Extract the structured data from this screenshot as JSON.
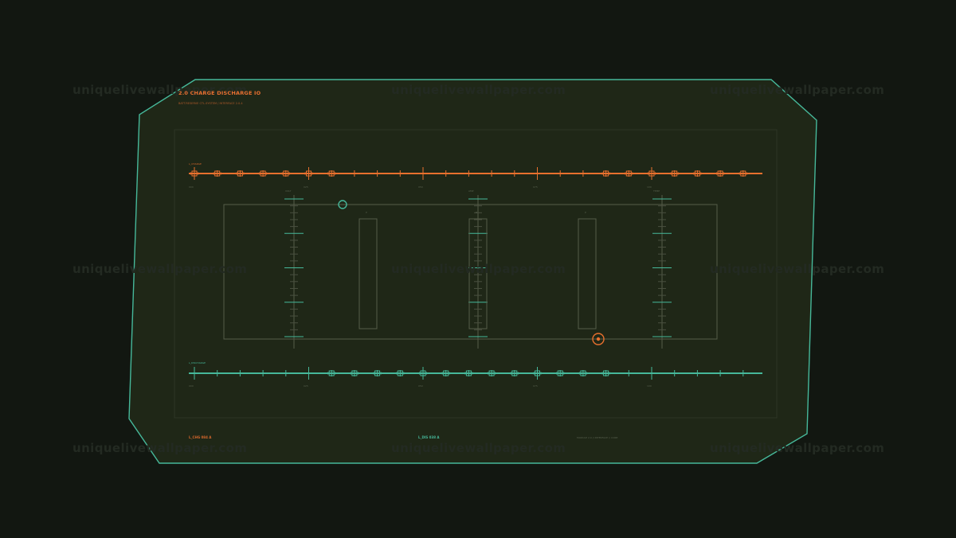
{
  "watermark": "uniquelivewallpaper.com",
  "panel": {
    "title": "2.0  CHARGE DISCHARGE IO",
    "subtitle": "BATT.RESERVE CTL.SYSTEM / INTERFACE 2.0.4"
  },
  "top_track": {
    "label": "L_CHARGE",
    "ticks": [
      "000",
      "025",
      "050",
      "075",
      "100"
    ]
  },
  "bottom_track": {
    "label": "L_DISCHARGE",
    "ticks": [
      "000",
      "025",
      "050",
      "075",
      "100"
    ]
  },
  "gauges": {
    "labels": [
      "P",
      "B",
      "P"
    ],
    "col_labels": [
      "VOLT",
      "AMP",
      "TEMP"
    ]
  },
  "footer": {
    "left": "L_CHG 084 A",
    "center": "L_DIS 038 A",
    "right": "MODULE 2.0  //  INTERFACE  //  CORE"
  },
  "colors": {
    "background": "#121711",
    "panel_fill": "#1f2717",
    "teal": "#46b89a",
    "orange": "#e8702e",
    "grid": "#4a5040"
  }
}
